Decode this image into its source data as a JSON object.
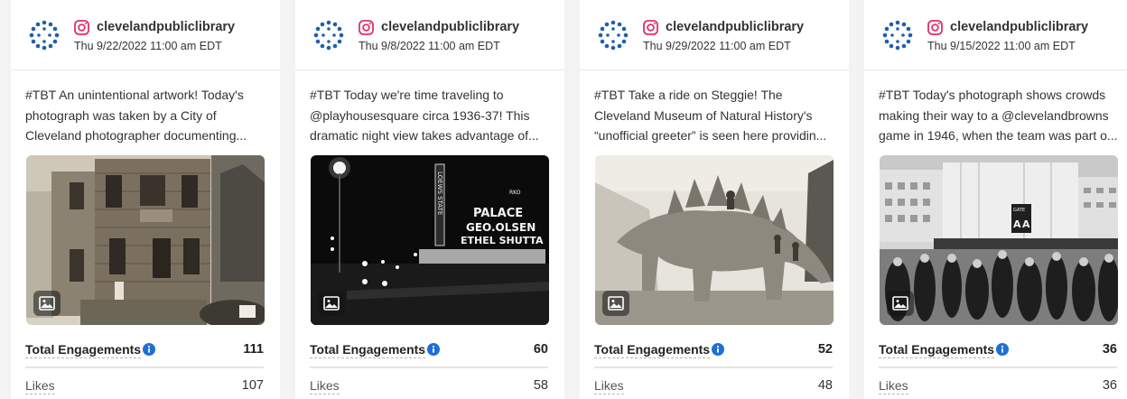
{
  "posts": [
    {
      "account": "clevelandpubliclibrary",
      "date": "Thu 9/22/2022 11:00 am EDT",
      "caption": [
        "#TBT An unintentional artwork! Today's",
        "photograph was taken by a City of",
        "Cleveland photographer documenting..."
      ],
      "total_engagements_label": "Total Engagements",
      "total_engagements": "111",
      "likes_label": "Likes",
      "likes": "107"
    },
    {
      "account": "clevelandpubliclibrary",
      "date": "Thu 9/8/2022 11:00 am EDT",
      "caption": [
        "#TBT Today we're time traveling to",
        "@playhousesquare circa 1936-37! This",
        "dramatic night view takes advantage of..."
      ],
      "photo_signs": [
        "LOEWS STATE",
        "RKO",
        "PALACE",
        "GEO.OLSEN",
        "ETHEL SHUTTA"
      ],
      "total_engagements_label": "Total Engagements",
      "total_engagements": "60",
      "likes_label": "Likes",
      "likes": "58"
    },
    {
      "account": "clevelandpubliclibrary",
      "date": "Thu 9/29/2022 11:00 am EDT",
      "caption": [
        "#TBT Take a ride on Steggie! The",
        "Cleveland Museum of Natural History's",
        "“unofficial greeter” is seen here providin..."
      ],
      "total_engagements_label": "Total Engagements",
      "total_engagements": "52",
      "likes_label": "Likes",
      "likes": "48"
    },
    {
      "account": "clevelandpubliclibrary",
      "date": "Thu 9/15/2022 11:00 am EDT",
      "caption": [
        "#TBT Today's photograph shows crowds",
        "making their way to a @clevelandbrowns",
        "game in 1946, when the team was part o..."
      ],
      "photo_signs": [
        "GATE",
        "A",
        "A"
      ],
      "total_engagements_label": "Total Engagements",
      "total_engagements": "36",
      "likes_label": "Likes",
      "likes": "36"
    }
  ],
  "colors": {
    "instagram": "#e1306c",
    "info_icon": "#1d6fd6",
    "avatar": "#1f5fae",
    "card_bg": "#ffffff",
    "page_bg": "#f3f3f3"
  },
  "icons": {
    "avatar": "library-logo-icon",
    "network": "instagram-icon",
    "info": "info-icon",
    "media": "image-icon"
  }
}
